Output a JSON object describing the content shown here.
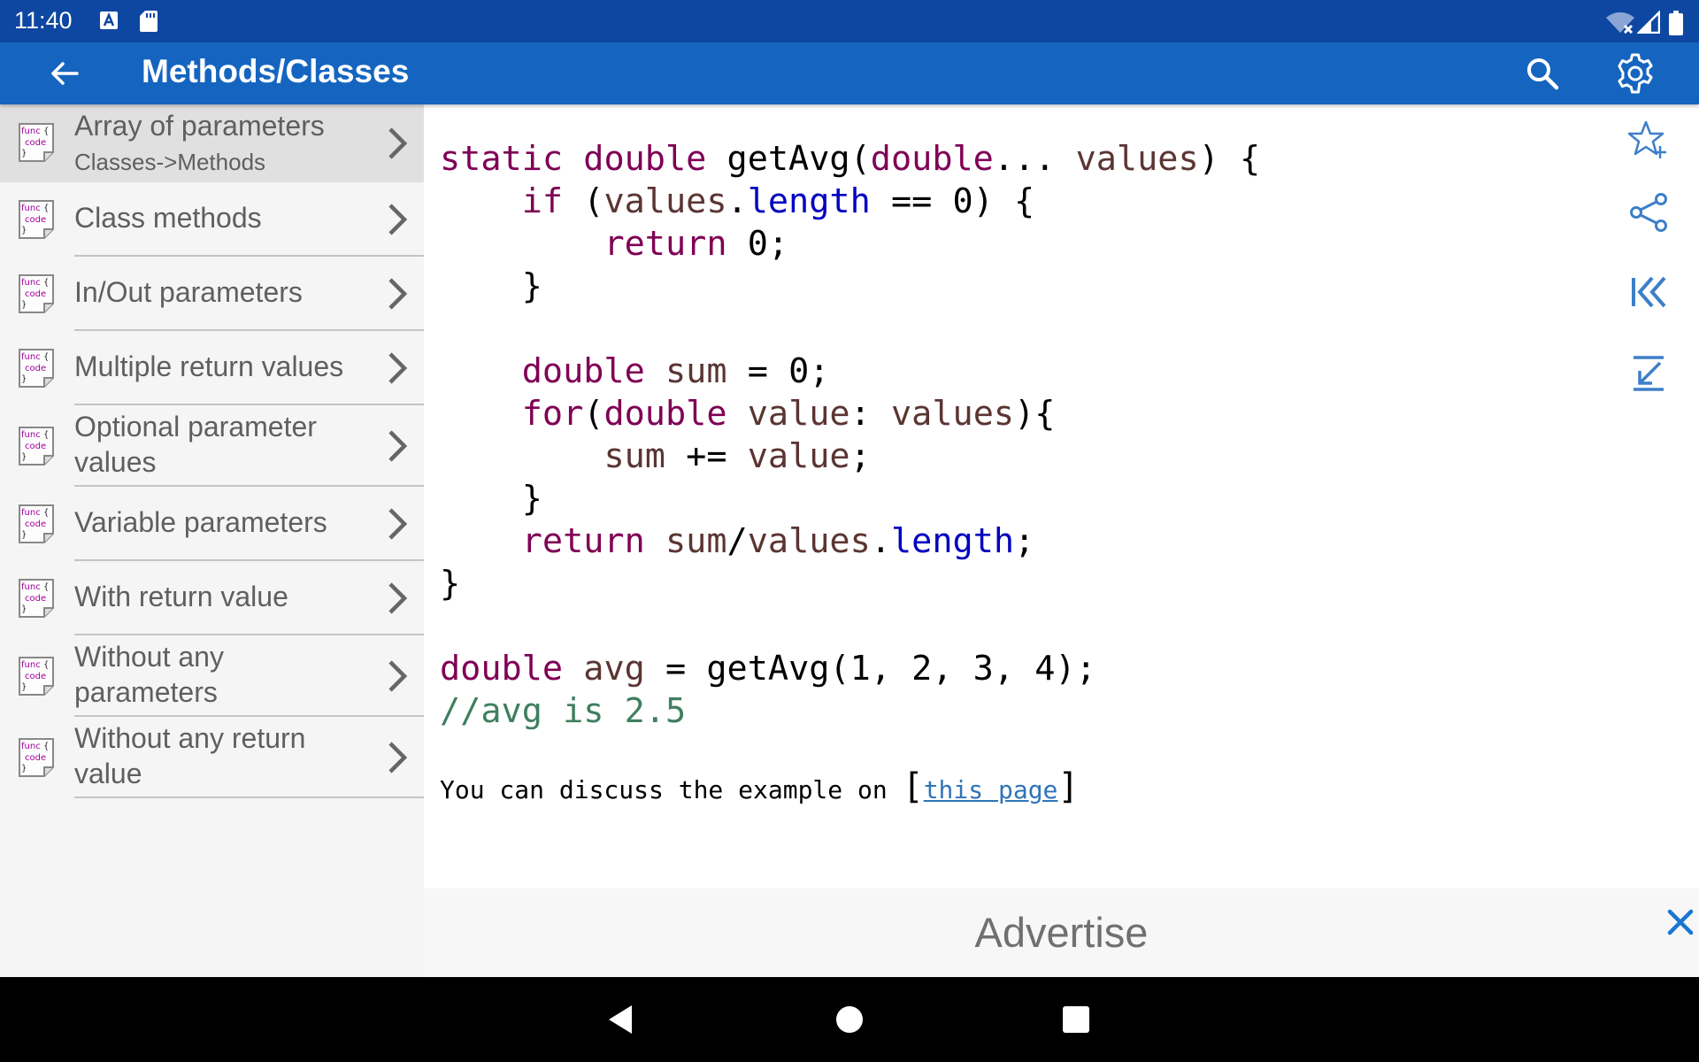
{
  "status_bar": {
    "time": "11:40",
    "icons": [
      "accessibility-icon",
      "sd-card-icon",
      "wifi-icon",
      "signal-icon",
      "battery-icon"
    ]
  },
  "app_bar": {
    "title": "Methods/Classes",
    "icons": [
      "back-arrow-icon",
      "search-icon",
      "gear-icon"
    ]
  },
  "sidebar": {
    "items": [
      {
        "label": "Array of parameters",
        "subtitle": "Classes->Methods",
        "active": true
      },
      {
        "label": "Class methods"
      },
      {
        "label": "In/Out parameters"
      },
      {
        "label": "Multiple return values"
      },
      {
        "label": "Optional parameter values"
      },
      {
        "label": "Variable parameters"
      },
      {
        "label": "With return value"
      },
      {
        "label": "Without any parameters"
      },
      {
        "label": "Without any return value"
      }
    ],
    "item_icon": "func-code-icon"
  },
  "content": {
    "code": "static double getAvg(double... values) {\n    if (values.length == 0) {\n        return 0;\n    }\n\n    double sum = 0;\n    for(double value: values){\n        sum += value;\n    }\n    return sum/values.length;\n}\n\ndouble avg = getAvg(1, 2, 3, 4);\n//avg is 2.5",
    "discuss_prefix": "You can discuss the example on ",
    "discuss_link": "this page",
    "discuss_open": "[",
    "discuss_close": "]",
    "tools": [
      "add-favorite-icon",
      "share-icon",
      "jump-first-icon",
      "jump-to-icon"
    ]
  },
  "ad": {
    "text": "Advertise",
    "close_icon": "close-icon"
  },
  "nav_bar": {
    "icons": [
      "nav-back-icon",
      "nav-home-icon",
      "nav-recents-icon"
    ]
  },
  "colors": {
    "status_bar": "#0d47a1",
    "app_bar": "#1565c0",
    "keyword": "#7f0055",
    "identifier": "#5b3533",
    "field": "#0000c0",
    "comment": "#3f7f5f",
    "link": "#2f74b9",
    "tool_icon": "#3d7fc8"
  }
}
